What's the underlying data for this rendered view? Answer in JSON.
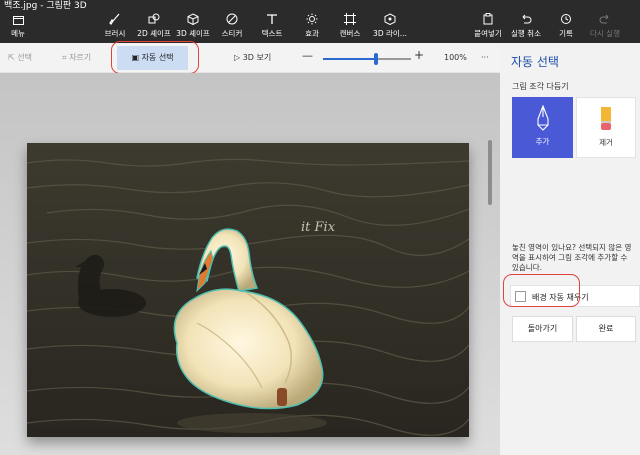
{
  "window": {
    "title": "백조.jpg - 그림판 3D"
  },
  "ribbon": {
    "menu": "메뉴",
    "tools": [
      {
        "label": "브러시",
        "icon": "brush-icon"
      },
      {
        "label": "2D 셰이프",
        "icon": "2d-shapes-icon"
      },
      {
        "label": "3D 셰이프",
        "icon": "3d-shapes-icon"
      },
      {
        "label": "스티커",
        "icon": "sticker-icon"
      },
      {
        "label": "텍스트",
        "icon": "text-icon"
      },
      {
        "label": "효과",
        "icon": "effects-icon"
      },
      {
        "label": "캔버스",
        "icon": "canvas-icon"
      },
      {
        "label": "3D 라이...",
        "icon": "3d-library-icon"
      }
    ],
    "paste": "붙여넣기",
    "undo": "실행 취소",
    "history": "기록",
    "redo": "다시 실행"
  },
  "toolbar": {
    "select": "선택",
    "crop": "자르기",
    "auto_select": "자동 선택",
    "view3d": "3D 보기",
    "zoom": "100%",
    "more": "···"
  },
  "canvas": {
    "watermark": "it Fix",
    "zoom_level": 0.6
  },
  "panel": {
    "title": "자동 선택",
    "subtitle": "그림 조각 다듬기",
    "add": "추가",
    "remove": "제거",
    "help": "놓친 영역이 있나요? 선택되지 않은 영역을 표시하여 그림 조각에 추가할 수 있습니다.",
    "autofill_label": "배경 자동 채우기",
    "back": "돌아가기",
    "done": "완료"
  },
  "colors": {
    "ribbon": "#2b2b2b",
    "accent": "#4a5ad6",
    "highlight": "#e0423c",
    "selected_tab": "#ccdcf2"
  }
}
